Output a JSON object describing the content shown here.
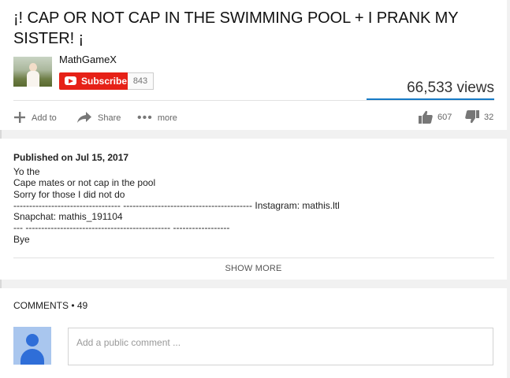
{
  "video": {
    "title": "¡! CAP OR NOT CAP IN THE SWIMMING POOL + I PRANK MY SISTER! ¡",
    "views": "66,533 views"
  },
  "channel": {
    "name": "MathGameX",
    "subscribe_label": "Subscribe",
    "subscriber_count": "843"
  },
  "actions": {
    "add_to": "Add to",
    "share": "Share",
    "more": "more",
    "likes": "607",
    "dislikes": "32"
  },
  "description": {
    "published": "Published on Jul 15, 2017",
    "text": "Yo the\nCape mates or not cap in the pool\nSorry for those I did not do\n---------------------------------- ----------------------------------------- Instagram: mathis.ltl\nSnapchat: mathis_191104\n--- ---------------------------------------------- ------------------\nBye",
    "show_more": "SHOW MORE"
  },
  "comments": {
    "header": "COMMENTS • 49",
    "placeholder": "Add a public comment ..."
  },
  "colors": {
    "subscribe_red": "#e62117",
    "views_bar_blue": "#167ac6",
    "avatar_blue": "#2f6ed8"
  }
}
